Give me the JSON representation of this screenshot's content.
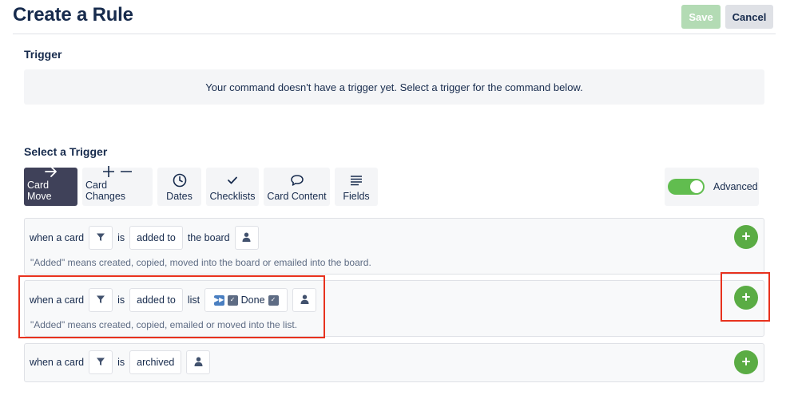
{
  "header": {
    "title": "Create a Rule",
    "save_label": "Save",
    "cancel_label": "Cancel"
  },
  "trigger_section": {
    "heading": "Trigger",
    "empty_message": "Your command doesn't have a trigger yet. Select a trigger for the command below."
  },
  "select_section": {
    "heading": "Select a Trigger",
    "tabs": [
      {
        "label": "Card Move",
        "icon": "arrow-right-icon",
        "active": true
      },
      {
        "label": "Card Changes",
        "icon": "plus-minus-icon",
        "active": false
      },
      {
        "label": "Dates",
        "icon": "clock-icon",
        "active": false
      },
      {
        "label": "Checklists",
        "icon": "checkmark-icon",
        "active": false
      },
      {
        "label": "Card Content",
        "icon": "speech-bubble-icon",
        "active": false
      },
      {
        "label": "Fields",
        "icon": "lines-icon",
        "active": false
      }
    ],
    "advanced_label": "Advanced",
    "advanced_enabled": true
  },
  "triggers": [
    {
      "when": "when a card",
      "is": "is",
      "action": "added to",
      "target": "the board",
      "hint": "\"Added\" means created, copied, moved into the board or emailed into the board."
    },
    {
      "when": "when a card",
      "is": "is",
      "action": "added to",
      "target": "list",
      "list_name": "Done",
      "hint": "\"Added\" means created, copied, emailed or moved into the list."
    },
    {
      "when": "when a card",
      "is": "is",
      "action": "archived"
    }
  ],
  "colors": {
    "accent_green": "#5aac44",
    "toggle_green": "#61bd4f",
    "active_tab": "#3f4159",
    "highlight_red": "#e8321e"
  }
}
